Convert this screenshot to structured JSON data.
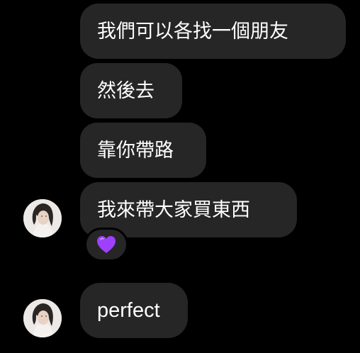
{
  "conversation": {
    "messages": [
      {
        "text": "我們可以各找一個朋友"
      },
      {
        "text": "然後去"
      },
      {
        "text": "靠你帶路"
      },
      {
        "text": "我來帶大家買東西",
        "reaction": "purple-heart"
      },
      {
        "text": "perfect"
      }
    ]
  },
  "colors": {
    "background": "#000000",
    "bubble": "#262626",
    "text": "#ffffff",
    "reaction_heart": "#a040ff"
  }
}
